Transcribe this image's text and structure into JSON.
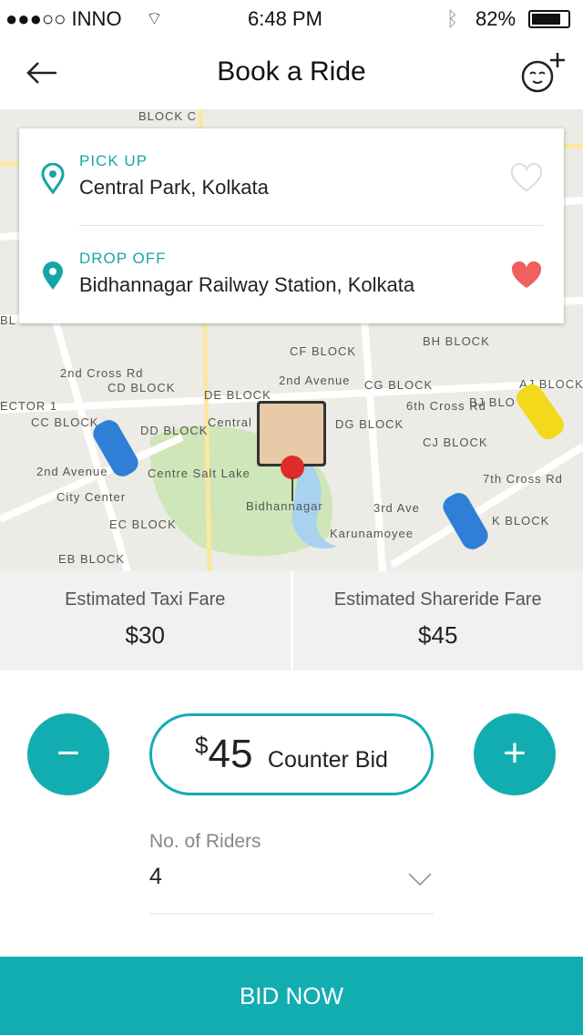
{
  "status": {
    "carrier": "●●●○○ INNO",
    "time": "6:48 PM",
    "battery": "82%",
    "battery_level": 82
  },
  "header": {
    "title": "Book a Ride",
    "back_icon": "arrow-left-icon",
    "profile_icon": "add-user-face-icon"
  },
  "map": {
    "labels": [
      "BLOCK C",
      "CF BLOCK",
      "BH BLOCK",
      "2nd Avenue",
      "AJ BLOCK",
      "CD BLOCK",
      "DE BLOCK",
      "CG BLOCK",
      "BJ BLO",
      "ECTOR 1",
      "CC BLOCK",
      "DD BLOCK",
      "Central Park",
      "DG BLOCK",
      "6th Cross Rd",
      "CJ BLOCK",
      "Centre Salt Lake",
      "2nd Avenue",
      "7th Cross Rd",
      "City Center",
      "Bidhannagar",
      "3rd Ave",
      "EC BLOCK",
      "Karunamoyee",
      "K BLOCK",
      "EB BLOCK",
      "2nd Cross Rd",
      "BL"
    ]
  },
  "pickup": {
    "label": "PICK UP",
    "value": "Central Park, Kolkata",
    "favorite": false
  },
  "dropoff": {
    "label": "DROP OFF",
    "value": "Bidhannagar Railway Station, Kolkata",
    "favorite": true
  },
  "fares": [
    {
      "label": "Estimated Taxi Fare",
      "value": "$30"
    },
    {
      "label": "Estimated Shareride Fare",
      "value": "$45"
    }
  ],
  "bid": {
    "currency": "$",
    "amount": "45",
    "label": "Counter Bid",
    "minus": "−",
    "plus": "+"
  },
  "riders": {
    "label": "No. of Riders",
    "value": "4"
  },
  "cta": "BID NOW",
  "colors": {
    "accent": "#12adb1",
    "heart": "#f0605e"
  }
}
